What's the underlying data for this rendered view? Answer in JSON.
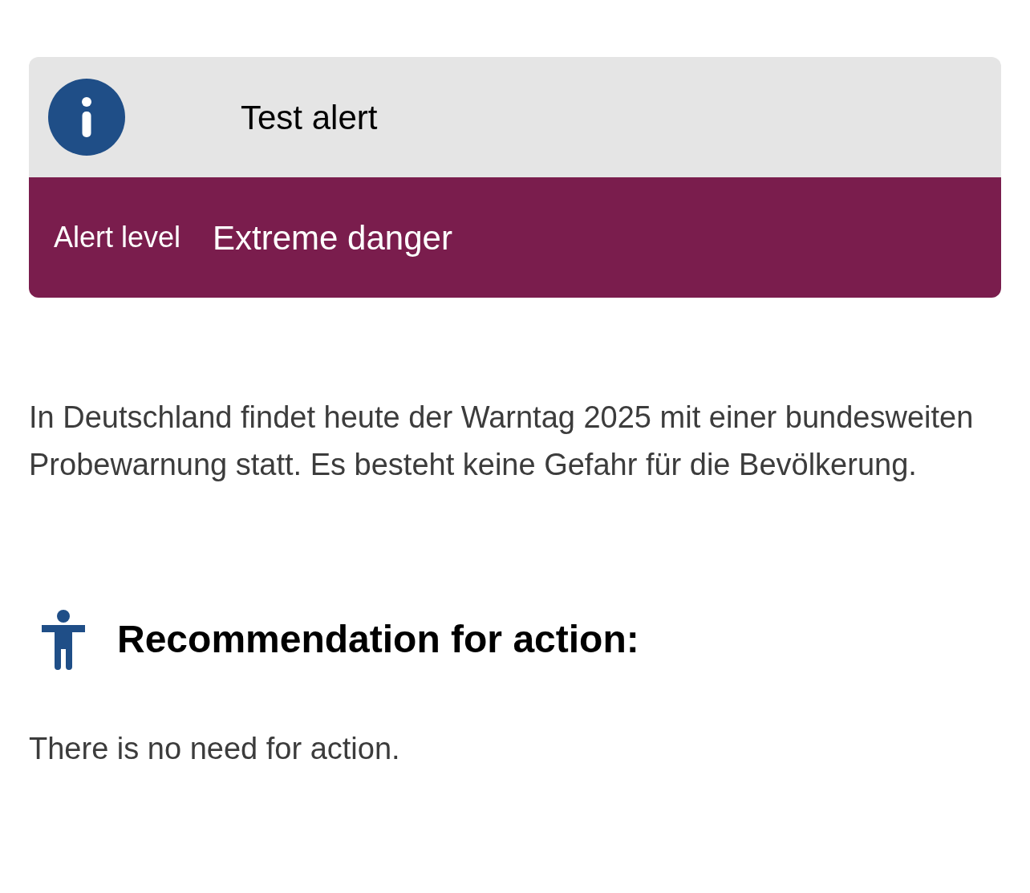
{
  "alert": {
    "title": "Test alert",
    "level_label": "Alert level",
    "level_value": "Extreme danger"
  },
  "description": "In Deutschland findet heute der Warntag 2025 mit einer bundesweiten Probewarnung statt. Es besteht keine Gefahr für die Bevölkerung.",
  "recommendation": {
    "heading": "Recommendation for action:",
    "text": "There is no need for action."
  }
}
